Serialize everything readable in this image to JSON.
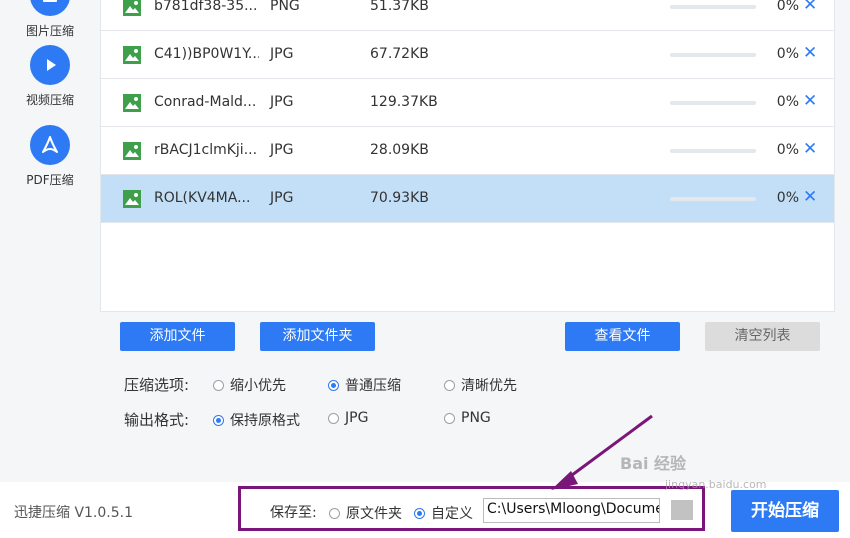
{
  "sidebar": {
    "items": [
      {
        "label": "图片压缩",
        "icon": "image-compress-icon"
      },
      {
        "label": "视频压缩",
        "icon": "play-icon"
      },
      {
        "label": "PDF压缩",
        "icon": "pdf-icon"
      }
    ]
  },
  "files": [
    {
      "name": "b781df38-35...",
      "type": "PNG",
      "size": "51.37KB",
      "progress": 0,
      "percent": "0%"
    },
    {
      "name": "C41))BP0W1Y...",
      "type": "JPG",
      "size": "67.72KB",
      "progress": 0,
      "percent": "0%"
    },
    {
      "name": "Conrad-Mald...",
      "type": "JPG",
      "size": "129.37KB",
      "progress": 0,
      "percent": "0%"
    },
    {
      "name": "rBACJ1clmKji...",
      "type": "JPG",
      "size": "28.09KB",
      "progress": 0,
      "percent": "0%"
    },
    {
      "name": "ROL(KV4MA...",
      "type": "JPG",
      "size": "70.93KB",
      "progress": 0,
      "percent": "0%",
      "selected": true
    }
  ],
  "close_symbol": "✕",
  "buttons": {
    "add_file": "添加文件",
    "add_folder": "添加文件夹",
    "view_files": "查看文件",
    "clear_list": "清空列表"
  },
  "options": {
    "compress_label": "压缩选项:",
    "compress_choices": [
      "缩小优先",
      "普通压缩",
      "清晰优先"
    ],
    "compress_selected": "普通压缩",
    "format_label": "输出格式:",
    "format_choices": [
      "保持原格式",
      "JPG",
      "PNG"
    ],
    "format_selected": "保持原格式"
  },
  "bottom": {
    "version": "迅捷压缩 V1.0.5.1",
    "save_label": "保存至:",
    "save_choices": [
      "原文件夹",
      "自定义"
    ],
    "save_selected": "自定义",
    "path_value": "C:\\Users\\Mloong\\Docume",
    "start_button": "开始压缩"
  },
  "watermark": {
    "text": "Bai  经验",
    "sub": "jingyan.baidu.com"
  },
  "colors": {
    "accent": "#2d7af4",
    "selected_row": "#c3dff8",
    "annotation": "#7a1679",
    "disabled_button": "#dcdcdc"
  }
}
